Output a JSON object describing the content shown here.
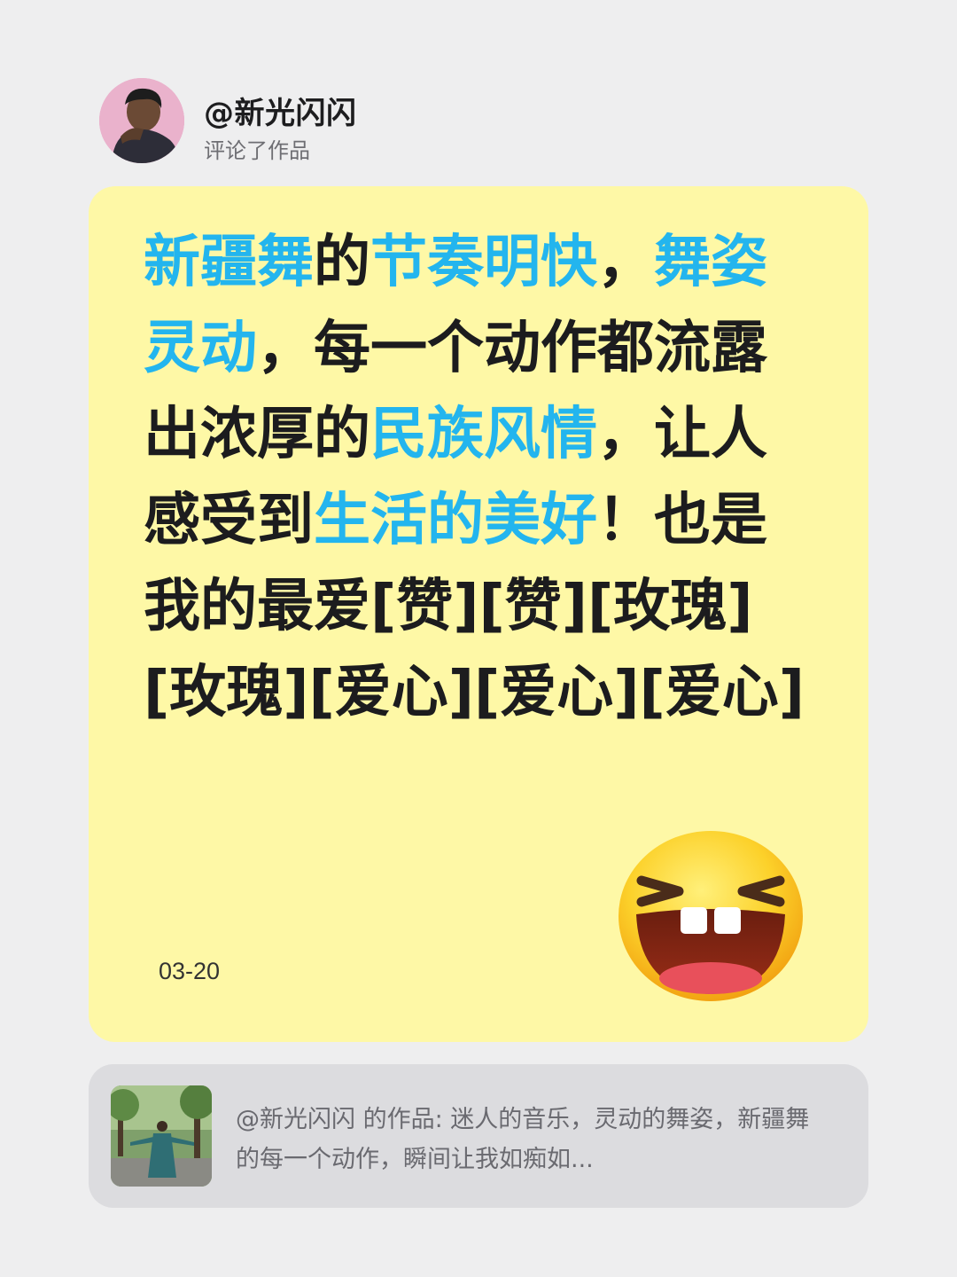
{
  "header": {
    "username": "@新光闪闪",
    "action": "评论了作品"
  },
  "comment": {
    "segments": [
      {
        "text": "新疆舞",
        "highlight": true
      },
      {
        "text": "的",
        "highlight": false
      },
      {
        "text": "节奏明快",
        "highlight": true
      },
      {
        "text": "，",
        "highlight": false
      },
      {
        "text": "舞姿灵动",
        "highlight": true
      },
      {
        "text": "，每一个动作都流露出浓厚的",
        "highlight": false
      },
      {
        "text": "民族风情",
        "highlight": true
      },
      {
        "text": "，让人感受到",
        "highlight": false
      },
      {
        "text": "生活的美好",
        "highlight": true
      },
      {
        "text": "！也是我的最爱[赞][赞][玫瑰][玫瑰][爱心][爱心][爱心]",
        "highlight": false
      }
    ],
    "date": "03-20",
    "emoji_icon": "laughing-face-icon",
    "colors": {
      "highlight": "#23b5ee",
      "text": "#1c1c1e",
      "card_background": "#fef8a6"
    }
  },
  "source": {
    "text": "@新光闪闪 的作品: 迷人的音乐，灵动的舞姿，新疆舞的每一个动作，瞬间让我如痴如..."
  }
}
